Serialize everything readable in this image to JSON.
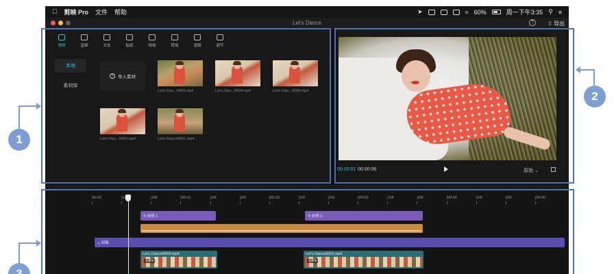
{
  "menubar": {
    "app_name": "剪映 Pro",
    "menu_file": "文件",
    "menu_help": "帮助",
    "battery": "60%",
    "clock": "周一下午3:35"
  },
  "window": {
    "title": "Let's Dance",
    "export_label": "导出",
    "help_glyph": "?"
  },
  "media": {
    "toolbar": [
      {
        "label": "视频",
        "icon": "video-icon",
        "active": true
      },
      {
        "label": "音频",
        "icon": "audio-icon",
        "active": false
      },
      {
        "label": "文本",
        "icon": "text-icon",
        "active": false
      },
      {
        "label": "贴纸",
        "icon": "sticker-icon",
        "active": false
      },
      {
        "label": "特效",
        "icon": "effect-icon",
        "active": false
      },
      {
        "label": "转场",
        "icon": "transition-icon",
        "active": false
      },
      {
        "label": "滤镜",
        "icon": "filter-icon",
        "active": false
      },
      {
        "label": "调节",
        "icon": "adjust-icon",
        "active": false
      }
    ],
    "side_tabs": [
      {
        "label": "本地",
        "active": true
      },
      {
        "label": "素材库",
        "active": false
      }
    ],
    "import_label": "导入素材",
    "clips": [
      {
        "name": "Let's Dan...0003.mp4",
        "thumb": "t-a"
      },
      {
        "name": "Let's Dan...0004.mp4",
        "thumb": "t-b"
      },
      {
        "name": "Let's Dan...0005.mp4",
        "thumb": "t-b"
      },
      {
        "name": "Let's Dan...0002.mp4",
        "thumb": "t-b"
      },
      {
        "name": "Let's Dance0001.mp4",
        "thumb": "t-c"
      }
    ]
  },
  "player": {
    "current_time": "00:00:01",
    "total_time": "00:00:06",
    "ratio_label": "原始"
  },
  "timeline": {
    "ruler": [
      "00:00",
      "|10f",
      "|20f",
      "|00:01",
      "|10f",
      "|20f",
      "|00:03",
      "|10f",
      "|20f",
      "|00:03",
      "|10f",
      "|20f",
      "|00:04",
      "|10f",
      "|20f",
      "|00:05"
    ],
    "text_track_label": "自然 1",
    "text_track_label_2": "自然 2",
    "main_track_label": "封面",
    "video_clip_1": "Let's Dance0004.mp4",
    "video_clip_2": "Let's Dance0003.mp4",
    "video_dur_1": "2.40s",
    "video_dur_2": "3.40s"
  },
  "annotations": {
    "badge_1": "1",
    "badge_2": "2",
    "badge_3": "3"
  },
  "colors": {
    "accent": "#2bc5d9",
    "annotation": "#4f72b5",
    "text_track": "#7a5bb8",
    "audio_track": "#c88a3c",
    "main_track": "#5a4fb0"
  }
}
